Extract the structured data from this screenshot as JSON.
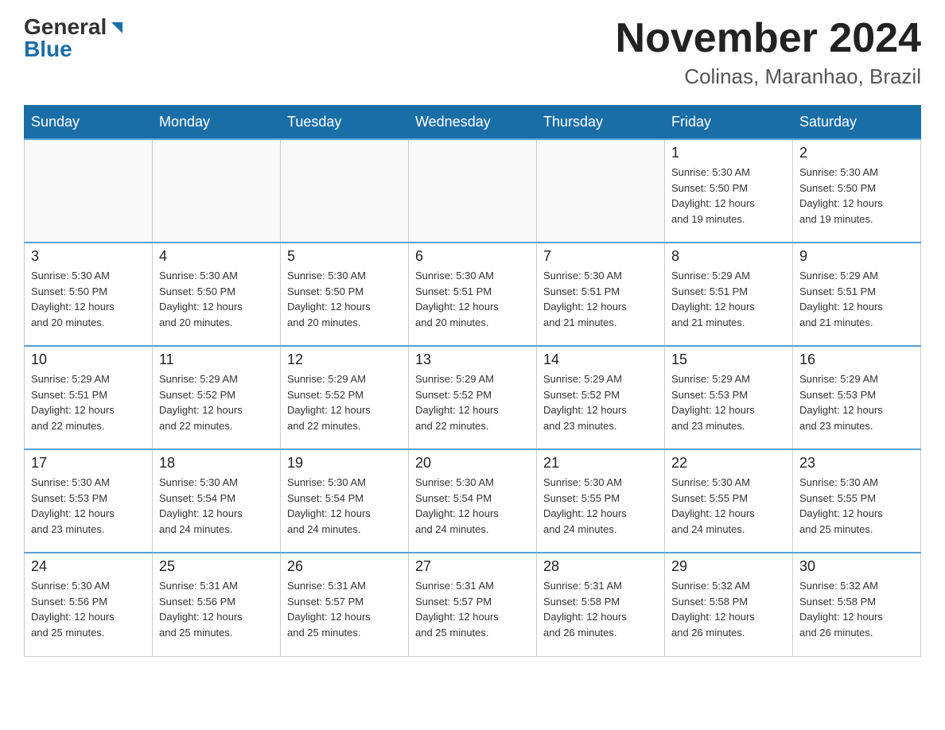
{
  "header": {
    "logo_general": "General",
    "logo_blue": "Blue",
    "month_title": "November 2024",
    "location": "Colinas, Maranhao, Brazil"
  },
  "weekdays": [
    "Sunday",
    "Monday",
    "Tuesday",
    "Wednesday",
    "Thursday",
    "Friday",
    "Saturday"
  ],
  "weeks": [
    [
      {
        "day": "",
        "info": ""
      },
      {
        "day": "",
        "info": ""
      },
      {
        "day": "",
        "info": ""
      },
      {
        "day": "",
        "info": ""
      },
      {
        "day": "",
        "info": ""
      },
      {
        "day": "1",
        "info": "Sunrise: 5:30 AM\nSunset: 5:50 PM\nDaylight: 12 hours\nand 19 minutes."
      },
      {
        "day": "2",
        "info": "Sunrise: 5:30 AM\nSunset: 5:50 PM\nDaylight: 12 hours\nand 19 minutes."
      }
    ],
    [
      {
        "day": "3",
        "info": "Sunrise: 5:30 AM\nSunset: 5:50 PM\nDaylight: 12 hours\nand 20 minutes."
      },
      {
        "day": "4",
        "info": "Sunrise: 5:30 AM\nSunset: 5:50 PM\nDaylight: 12 hours\nand 20 minutes."
      },
      {
        "day": "5",
        "info": "Sunrise: 5:30 AM\nSunset: 5:50 PM\nDaylight: 12 hours\nand 20 minutes."
      },
      {
        "day": "6",
        "info": "Sunrise: 5:30 AM\nSunset: 5:51 PM\nDaylight: 12 hours\nand 20 minutes."
      },
      {
        "day": "7",
        "info": "Sunrise: 5:30 AM\nSunset: 5:51 PM\nDaylight: 12 hours\nand 21 minutes."
      },
      {
        "day": "8",
        "info": "Sunrise: 5:29 AM\nSunset: 5:51 PM\nDaylight: 12 hours\nand 21 minutes."
      },
      {
        "day": "9",
        "info": "Sunrise: 5:29 AM\nSunset: 5:51 PM\nDaylight: 12 hours\nand 21 minutes."
      }
    ],
    [
      {
        "day": "10",
        "info": "Sunrise: 5:29 AM\nSunset: 5:51 PM\nDaylight: 12 hours\nand 22 minutes."
      },
      {
        "day": "11",
        "info": "Sunrise: 5:29 AM\nSunset: 5:52 PM\nDaylight: 12 hours\nand 22 minutes."
      },
      {
        "day": "12",
        "info": "Sunrise: 5:29 AM\nSunset: 5:52 PM\nDaylight: 12 hours\nand 22 minutes."
      },
      {
        "day": "13",
        "info": "Sunrise: 5:29 AM\nSunset: 5:52 PM\nDaylight: 12 hours\nand 22 minutes."
      },
      {
        "day": "14",
        "info": "Sunrise: 5:29 AM\nSunset: 5:52 PM\nDaylight: 12 hours\nand 23 minutes."
      },
      {
        "day": "15",
        "info": "Sunrise: 5:29 AM\nSunset: 5:53 PM\nDaylight: 12 hours\nand 23 minutes."
      },
      {
        "day": "16",
        "info": "Sunrise: 5:29 AM\nSunset: 5:53 PM\nDaylight: 12 hours\nand 23 minutes."
      }
    ],
    [
      {
        "day": "17",
        "info": "Sunrise: 5:30 AM\nSunset: 5:53 PM\nDaylight: 12 hours\nand 23 minutes."
      },
      {
        "day": "18",
        "info": "Sunrise: 5:30 AM\nSunset: 5:54 PM\nDaylight: 12 hours\nand 24 minutes."
      },
      {
        "day": "19",
        "info": "Sunrise: 5:30 AM\nSunset: 5:54 PM\nDaylight: 12 hours\nand 24 minutes."
      },
      {
        "day": "20",
        "info": "Sunrise: 5:30 AM\nSunset: 5:54 PM\nDaylight: 12 hours\nand 24 minutes."
      },
      {
        "day": "21",
        "info": "Sunrise: 5:30 AM\nSunset: 5:55 PM\nDaylight: 12 hours\nand 24 minutes."
      },
      {
        "day": "22",
        "info": "Sunrise: 5:30 AM\nSunset: 5:55 PM\nDaylight: 12 hours\nand 24 minutes."
      },
      {
        "day": "23",
        "info": "Sunrise: 5:30 AM\nSunset: 5:55 PM\nDaylight: 12 hours\nand 25 minutes."
      }
    ],
    [
      {
        "day": "24",
        "info": "Sunrise: 5:30 AM\nSunset: 5:56 PM\nDaylight: 12 hours\nand 25 minutes."
      },
      {
        "day": "25",
        "info": "Sunrise: 5:31 AM\nSunset: 5:56 PM\nDaylight: 12 hours\nand 25 minutes."
      },
      {
        "day": "26",
        "info": "Sunrise: 5:31 AM\nSunset: 5:57 PM\nDaylight: 12 hours\nand 25 minutes."
      },
      {
        "day": "27",
        "info": "Sunrise: 5:31 AM\nSunset: 5:57 PM\nDaylight: 12 hours\nand 25 minutes."
      },
      {
        "day": "28",
        "info": "Sunrise: 5:31 AM\nSunset: 5:58 PM\nDaylight: 12 hours\nand 26 minutes."
      },
      {
        "day": "29",
        "info": "Sunrise: 5:32 AM\nSunset: 5:58 PM\nDaylight: 12 hours\nand 26 minutes."
      },
      {
        "day": "30",
        "info": "Sunrise: 5:32 AM\nSunset: 5:58 PM\nDaylight: 12 hours\nand 26 minutes."
      }
    ]
  ]
}
